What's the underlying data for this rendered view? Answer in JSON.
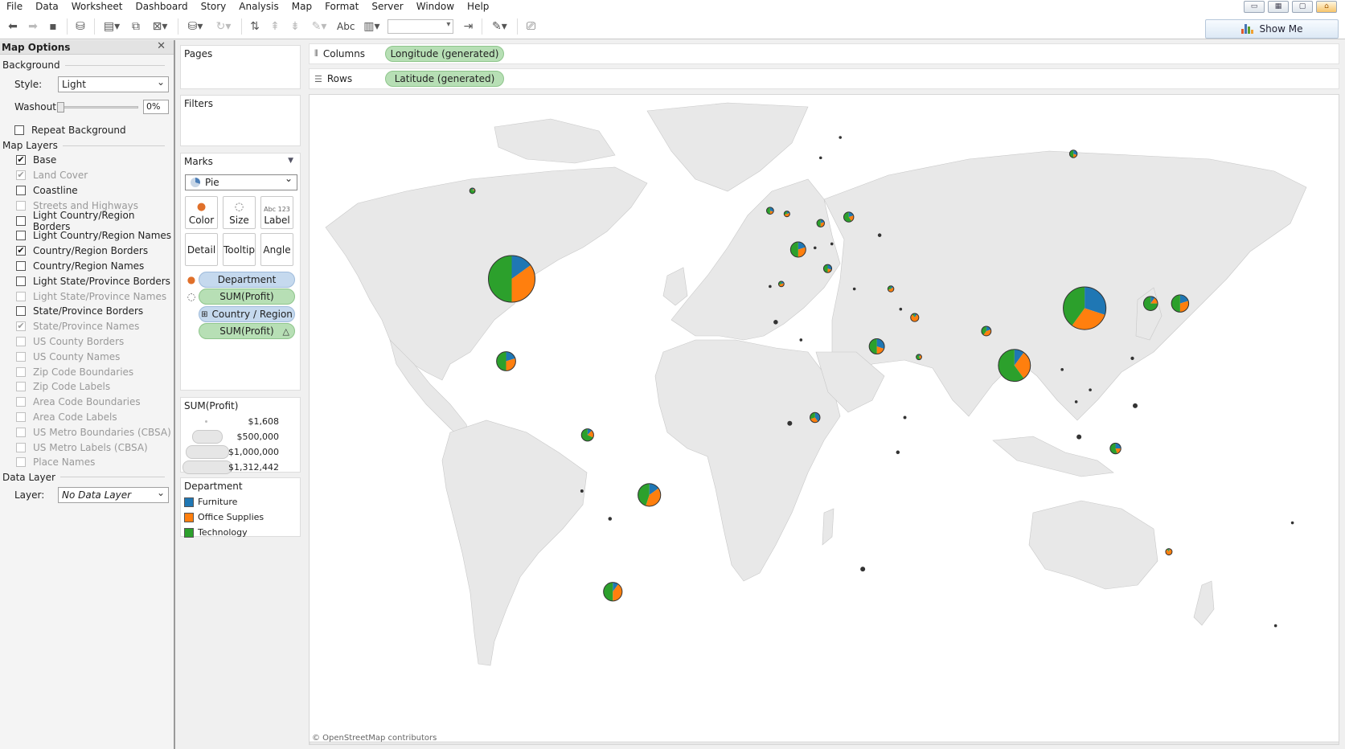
{
  "menu": [
    "File",
    "Data",
    "Worksheet",
    "Dashboard",
    "Story",
    "Analysis",
    "Map",
    "Format",
    "Server",
    "Window",
    "Help"
  ],
  "toolbar": {
    "abc_label": "Abc",
    "show_me_label": "Show Me",
    "show_me_colors": [
      "#e05a2a",
      "#4575b4",
      "#5aa02c",
      "#f0a030"
    ]
  },
  "map_options": {
    "title": "Map Options",
    "close_glyph": "✕",
    "background_head": "Background",
    "style_label": "Style:",
    "style_value": "Light",
    "washout_label": "Washout:",
    "washout_value": "0%",
    "repeat_background_label": "Repeat Background",
    "layers_head": "Map Layers",
    "layers": [
      {
        "label": "Base",
        "checked": true,
        "enabled": true
      },
      {
        "label": "Land Cover",
        "checked": true,
        "enabled": false
      },
      {
        "label": "Coastline",
        "checked": false,
        "enabled": true
      },
      {
        "label": "Streets and Highways",
        "checked": false,
        "enabled": false
      },
      {
        "label": "Light Country/Region Borders",
        "checked": false,
        "enabled": true
      },
      {
        "label": "Light Country/Region Names",
        "checked": false,
        "enabled": true
      },
      {
        "label": "Country/Region Borders",
        "checked": true,
        "enabled": true
      },
      {
        "label": "Country/Region Names",
        "checked": false,
        "enabled": true
      },
      {
        "label": "Light State/Province Borders",
        "checked": false,
        "enabled": true
      },
      {
        "label": "Light State/Province Names",
        "checked": false,
        "enabled": false
      },
      {
        "label": "State/Province Borders",
        "checked": false,
        "enabled": true
      },
      {
        "label": "State/Province Names",
        "checked": true,
        "enabled": false
      },
      {
        "label": "US County Borders",
        "checked": false,
        "enabled": false
      },
      {
        "label": "US County Names",
        "checked": false,
        "enabled": false
      },
      {
        "label": "Zip Code Boundaries",
        "checked": false,
        "enabled": false
      },
      {
        "label": "Zip Code Labels",
        "checked": false,
        "enabled": false
      },
      {
        "label": "Area Code Boundaries",
        "checked": false,
        "enabled": false
      },
      {
        "label": "Area Code Labels",
        "checked": false,
        "enabled": false
      },
      {
        "label": "US Metro Boundaries (CBSA)",
        "checked": false,
        "enabled": false
      },
      {
        "label": "US Metro Labels (CBSA)",
        "checked": false,
        "enabled": false
      },
      {
        "label": "Place Names",
        "checked": false,
        "enabled": false
      }
    ],
    "data_layer_head": "Data Layer",
    "layer_label": "Layer:",
    "layer_value": "No Data Layer"
  },
  "cards": {
    "pages": "Pages",
    "filters": "Filters",
    "marks": "Marks",
    "mark_type": "Pie",
    "buttons": {
      "color": "Color",
      "size": "Size",
      "label": "Label",
      "detail": "Detail",
      "tooltip": "Tooltip",
      "angle": "Angle",
      "label_icon": "Abc 123"
    },
    "pills": [
      {
        "icon": "color",
        "label": "Department",
        "kind": "blue"
      },
      {
        "icon": "size",
        "label": "SUM(Profit)",
        "kind": "green"
      },
      {
        "icon": "detail",
        "label": "Country / Region",
        "kind": "blue"
      },
      {
        "icon": "angle",
        "label": "SUM(Profit)",
        "kind": "green"
      }
    ],
    "size_legend_title": "SUM(Profit)",
    "size_legend": [
      "$1,608",
      "$500,000",
      "$1,000,000",
      "$1,312,442"
    ],
    "dept_legend_title": "Department",
    "departments": [
      {
        "label": "Furniture",
        "color": "#1f77b4"
      },
      {
        "label": "Office Supplies",
        "color": "#ff7f0e"
      },
      {
        "label": "Technology",
        "color": "#2ca02c"
      }
    ]
  },
  "shelves": {
    "columns_label": "Columns",
    "columns_pill": "Longitude (generated)",
    "rows_label": "Rows",
    "rows_pill": "Latitude (generated)"
  },
  "map": {
    "attribution": "© OpenStreetMap contributors",
    "land_color": "#e8e8e8",
    "pies": [
      {
        "name": "usa",
        "lon": -100,
        "lat": 41,
        "profit": 1312442,
        "f": 0.15,
        "o": 0.35,
        "t": 0.5
      },
      {
        "name": "canada",
        "lon": -114,
        "lat": 56,
        "profit": 18000,
        "f": 0.1,
        "o": 0.1,
        "t": 0.8
      },
      {
        "name": "mexico",
        "lon": -102,
        "lat": 23,
        "profit": 220000,
        "f": 0.2,
        "o": 0.3,
        "t": 0.5
      },
      {
        "name": "colombia",
        "lon": -73,
        "lat": 4.5,
        "profit": 90000,
        "f": 0.12,
        "o": 0.2,
        "t": 0.68
      },
      {
        "name": "peru",
        "lon": -75,
        "lat": -10,
        "profit": 6000,
        "f": 0.2,
        "o": 0.2,
        "t": 0.6
      },
      {
        "name": "bolivia",
        "lon": -65,
        "lat": -17,
        "profit": 8000,
        "f": 0.2,
        "o": 0.5,
        "t": 0.3
      },
      {
        "name": "brazil",
        "lon": -51,
        "lat": -11,
        "profit": 310000,
        "f": 0.15,
        "o": 0.4,
        "t": 0.45
      },
      {
        "name": "argentina",
        "lon": -64,
        "lat": -34,
        "profit": 210000,
        "f": 0.1,
        "o": 0.4,
        "t": 0.5
      },
      {
        "name": "ireland",
        "lon": -8,
        "lat": 53,
        "profit": 30000,
        "f": 0.3,
        "o": 0.2,
        "t": 0.5
      },
      {
        "name": "uk",
        "lon": -2,
        "lat": 52.5,
        "profit": 20000,
        "f": 0.2,
        "o": 0.5,
        "t": 0.3
      },
      {
        "name": "france",
        "lon": 2,
        "lat": 46.5,
        "profit": 140000,
        "f": 0.2,
        "o": 0.3,
        "t": 0.5
      },
      {
        "name": "germany",
        "lon": 10,
        "lat": 51,
        "profit": 35000,
        "f": 0.2,
        "o": 0.3,
        "t": 0.5
      },
      {
        "name": "poland",
        "lon": 20,
        "lat": 52,
        "profit": 60000,
        "f": 0.2,
        "o": 0.2,
        "t": 0.6
      },
      {
        "name": "austria",
        "lon": 14,
        "lat": 47.5,
        "profit": 4000,
        "f": 0.3,
        "o": 0.3,
        "t": 0.4
      },
      {
        "name": "switzerland",
        "lon": 8,
        "lat": 46.8,
        "profit": 2500,
        "f": 0.3,
        "o": 0.3,
        "t": 0.4
      },
      {
        "name": "italy",
        "lon": 12.5,
        "lat": 43,
        "profit": 40000,
        "f": 0.3,
        "o": 0.2,
        "t": 0.5
      },
      {
        "name": "ukraine",
        "lon": 31,
        "lat": 49,
        "profit": 8000,
        "f": 0.3,
        "o": 0.2,
        "t": 0.5
      },
      {
        "name": "sweden",
        "lon": 17,
        "lat": 63,
        "profit": 4000,
        "f": 0.2,
        "o": 0.6,
        "t": 0.2
      },
      {
        "name": "norway",
        "lon": 10,
        "lat": 60.5,
        "profit": 1608,
        "f": 0.5,
        "o": 0.3,
        "t": 0.2
      },
      {
        "name": "russia",
        "lon": 100,
        "lat": 61,
        "profit": 35000,
        "f": 0.3,
        "o": 0.2,
        "t": 0.5
      },
      {
        "name": "portugal",
        "lon": -8,
        "lat": 39.5,
        "profit": 1608,
        "f": 0.5,
        "o": 0.3,
        "t": 0.2
      },
      {
        "name": "spain",
        "lon": -4,
        "lat": 40,
        "profit": 18000,
        "f": 0.2,
        "o": 0.5,
        "t": 0.3
      },
      {
        "name": "greece",
        "lon": 22,
        "lat": 39,
        "profit": 1608,
        "f": 0.3,
        "o": 0.4,
        "t": 0.3
      },
      {
        "name": "turkey",
        "lon": 35,
        "lat": 39,
        "profit": 22000,
        "f": 0.15,
        "o": 0.55,
        "t": 0.3
      },
      {
        "name": "morocco",
        "lon": -6,
        "lat": 32,
        "profit": 12000,
        "f": 0.3,
        "o": 0.2,
        "t": 0.5
      },
      {
        "name": "algeria",
        "lon": 3,
        "lat": 28,
        "profit": 2500,
        "f": 0.4,
        "o": 0.2,
        "t": 0.4
      },
      {
        "name": "egypt",
        "lon": 30,
        "lat": 26.5,
        "profit": 140000,
        "f": 0.3,
        "o": 0.2,
        "t": 0.5
      },
      {
        "name": "syria",
        "lon": 38.5,
        "lat": 34.8,
        "profit": 2500,
        "f": 0.3,
        "o": 0.4,
        "t": 0.3
      },
      {
        "name": "iraq",
        "lon": 43.5,
        "lat": 33,
        "profit": 40000,
        "f": 0.1,
        "o": 0.8,
        "t": 0.1
      },
      {
        "name": "saudi",
        "lon": 45,
        "lat": 24,
        "profit": 18000,
        "f": 0.1,
        "o": 0.3,
        "t": 0.6
      },
      {
        "name": "pakistan",
        "lon": 69,
        "lat": 30,
        "profit": 55000,
        "f": 0.2,
        "o": 0.4,
        "t": 0.4
      },
      {
        "name": "india",
        "lon": 79,
        "lat": 22,
        "profit": 620000,
        "f": 0.1,
        "o": 0.3,
        "t": 0.6
      },
      {
        "name": "china",
        "lon": 104,
        "lat": 35,
        "profit": 1100000,
        "f": 0.3,
        "o": 0.3,
        "t": 0.4
      },
      {
        "name": "korea",
        "lon": 127.5,
        "lat": 36,
        "profit": 120000,
        "f": 0.1,
        "o": 0.15,
        "t": 0.75
      },
      {
        "name": "japan",
        "lon": 138,
        "lat": 36,
        "profit": 180000,
        "f": 0.2,
        "o": 0.3,
        "t": 0.5
      },
      {
        "name": "taiwan",
        "lon": 121,
        "lat": 23.7,
        "profit": 7000,
        "f": 0.2,
        "o": 0.3,
        "t": 0.5
      },
      {
        "name": "myanmar",
        "lon": 96,
        "lat": 21,
        "profit": 1608,
        "f": 0.4,
        "o": 0.3,
        "t": 0.3
      },
      {
        "name": "vietnam",
        "lon": 106,
        "lat": 16,
        "profit": 1608,
        "f": 0.4,
        "o": 0.3,
        "t": 0.3
      },
      {
        "name": "philippines",
        "lon": 122,
        "lat": 12,
        "profit": 14000,
        "f": 0.1,
        "o": 0.6,
        "t": 0.3
      },
      {
        "name": "thailand",
        "lon": 101,
        "lat": 13,
        "profit": 2500,
        "f": 0.3,
        "o": 0.3,
        "t": 0.4
      },
      {
        "name": "malaysia",
        "lon": 102,
        "lat": 4,
        "profit": 14000,
        "f": 0.2,
        "o": 0.3,
        "t": 0.5
      },
      {
        "name": "indonesia",
        "lon": 115,
        "lat": 1,
        "profit": 70000,
        "f": 0.25,
        "o": 0.2,
        "t": 0.55
      },
      {
        "name": "nigeria",
        "lon": 8,
        "lat": 9,
        "profit": 60000,
        "f": 0.4,
        "o": 0.3,
        "t": 0.3
      },
      {
        "name": "ghana",
        "lon": -1,
        "lat": 7.5,
        "profit": 14000,
        "f": 0.2,
        "o": 0.2,
        "t": 0.6
      },
      {
        "name": "ethiopia",
        "lon": 40,
        "lat": 9,
        "profit": 6000,
        "f": 0.4,
        "o": 0.5,
        "t": 0.1
      },
      {
        "name": "kenya",
        "lon": 37.5,
        "lat": 0,
        "profit": 8000,
        "f": 0.2,
        "o": 0.3,
        "t": 0.5
      },
      {
        "name": "southafrica",
        "lon": 25,
        "lat": -29,
        "profit": 14000,
        "f": 0.1,
        "o": 0.1,
        "t": 0.8
      },
      {
        "name": "australia",
        "lon": 134,
        "lat": -25,
        "profit": 25000,
        "f": 0.05,
        "o": 0.85,
        "t": 0.1
      },
      {
        "name": "newzealand",
        "lon": 172,
        "lat": -41,
        "profit": 5000,
        "f": 0.2,
        "o": 0.2,
        "t": 0.6
      },
      {
        "name": "fiji",
        "lon": 178,
        "lat": -18,
        "profit": 1608,
        "f": 0.4,
        "o": 0.3,
        "t": 0.3
      }
    ]
  }
}
